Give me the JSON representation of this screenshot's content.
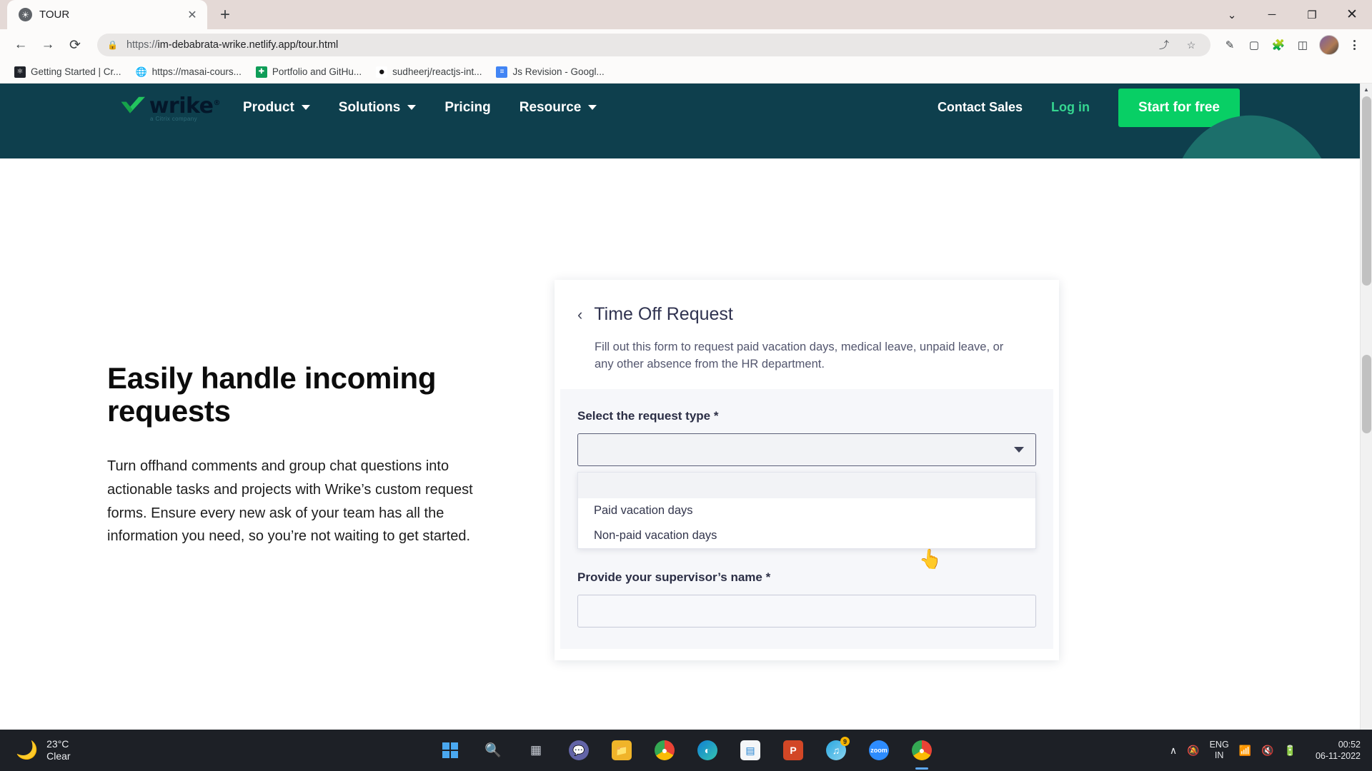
{
  "browser": {
    "tab": {
      "title": "TOUR",
      "favicon_icon": "globe-icon",
      "close_icon": "✕"
    },
    "new_tab_icon": "+",
    "window_controls": {
      "minimize_all": "⌄",
      "minimize": "─",
      "maximize": "❐",
      "close": "✕"
    },
    "nav": {
      "back": "←",
      "forward": "→",
      "reload": "⟳"
    },
    "omnibox": {
      "lock_icon": "🔒",
      "url_scheme": "https://",
      "url_rest": "im-debabrata-wrike.netlify.app/tour.html",
      "share_icon": "⤴",
      "bookmark_icon": "☆"
    },
    "toolbar_icons": [
      "highlighter-icon",
      "reading-list-icon",
      "extensions-icon",
      "side-panel-icon"
    ],
    "bookmarks": [
      {
        "label": "Getting Started | Cr...",
        "icon_text": "⚛",
        "icon_color": "#20232a"
      },
      {
        "label": "https://masai-cours...",
        "icon_text": "🌐",
        "icon_color": "#3c4043"
      },
      {
        "label": "Portfolio and GitHu...",
        "icon_text": "✚",
        "icon_color": "#0f9d58"
      },
      {
        "label": "sudheerj/reactjs-int...",
        "icon_text": "●",
        "icon_color": "#171515"
      },
      {
        "label": "Js Revision - Googl...",
        "icon_text": "≡",
        "icon_color": "#4285f4"
      }
    ]
  },
  "site": {
    "logo": {
      "word": "wrike",
      "registered": "®",
      "subtitle": "a Citrix company"
    },
    "nav_items": [
      {
        "label": "Product",
        "has_caret": true
      },
      {
        "label": "Solutions",
        "has_caret": true
      },
      {
        "label": "Pricing",
        "has_caret": false
      },
      {
        "label": "Resource",
        "has_caret": true
      }
    ],
    "contact_sales": "Contact Sales",
    "login": "Log in",
    "cta": "Start for free",
    "colors": {
      "header_bg": "#0e3f4d",
      "cta_green": "#08cf65",
      "login_green": "#35d690"
    }
  },
  "left": {
    "heading_line1": "Easily handle incoming",
    "heading_line2": "requests",
    "paragraph": "Turn offhand comments and group chat questions into actionable tasks and projects with Wrike’s custom request forms. Ensure every new ask of your team has all the information you need, so you’re not waiting to get started."
  },
  "form": {
    "back_icon": "‹",
    "title": "Time Off Request",
    "description": "Fill out this form to request paid vacation days, medical leave, unpaid leave, or any other absence from the HR department.",
    "request_type_label": "Select the request type *",
    "request_type_value": "",
    "dropdown_open": true,
    "dropdown_options": [
      "Paid vacation days",
      "Non-paid vacation days"
    ],
    "supervisor_label": "Provide your supervisor’s name *",
    "supervisor_value": ""
  },
  "taskbar": {
    "weather": {
      "temp": "23°C",
      "condition": "Clear",
      "icon": "moon-icon"
    },
    "apps": [
      {
        "name": "start-button",
        "icon": "windows-logo-icon"
      },
      {
        "name": "search-button",
        "icon": "🔍"
      },
      {
        "name": "task-view-button",
        "icon": "❐"
      },
      {
        "name": "teams-button",
        "icon": "📹"
      },
      {
        "name": "file-explorer-button",
        "icon": "📁"
      },
      {
        "name": "chrome-button",
        "icon": "◉"
      },
      {
        "name": "edge-button",
        "icon": "◐"
      },
      {
        "name": "store-button",
        "icon": "🛍"
      },
      {
        "name": "powerpoint-button",
        "icon": "P"
      },
      {
        "name": "media-player-button",
        "icon": "♪",
        "badge": "9"
      },
      {
        "name": "zoom-button",
        "icon": "zoom"
      },
      {
        "name": "chrome-active-button",
        "icon": "◉"
      }
    ],
    "tray": {
      "chevron": "∧",
      "notify_off": "🔕",
      "wifi": "📶",
      "volume_muted": "🔇",
      "battery": "🔋"
    },
    "language": {
      "line1": "ENG",
      "line2": "IN"
    },
    "clock": {
      "time": "00:52",
      "date": "06-11-2022"
    }
  }
}
